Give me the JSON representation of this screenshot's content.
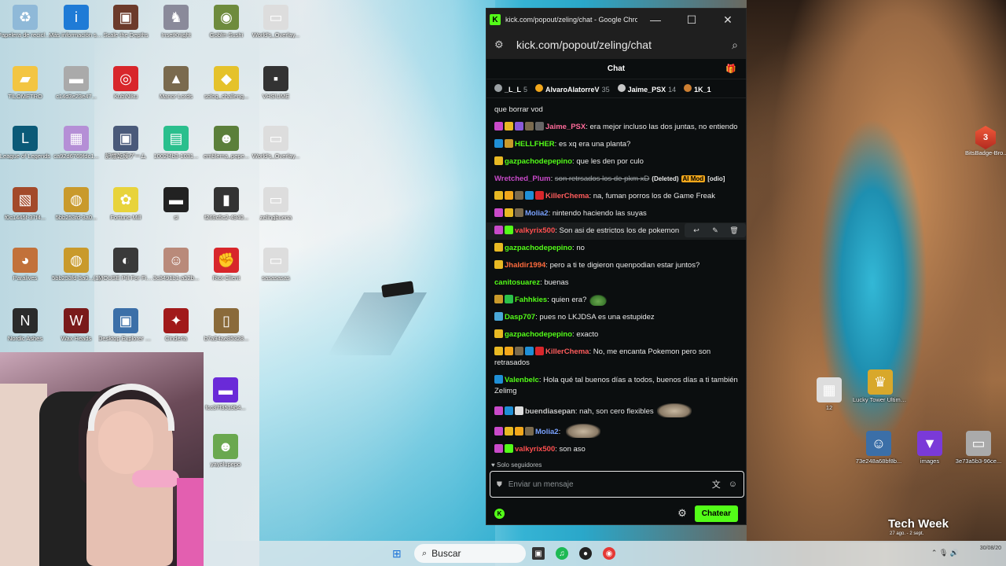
{
  "desktop": {
    "icons": [
      {
        "label": "Papelera de reciclaje",
        "color": "#8fb9d8",
        "glyph": "♻"
      },
      {
        "label": "Más información sobre esta ima...",
        "color": "#1f7bd6",
        "glyph": "i"
      },
      {
        "label": "Scale the Depths",
        "color": "#6c3b2b",
        "glyph": "▣"
      },
      {
        "label": "InsetKnight",
        "color": "#8a8a9a",
        "glyph": "♞"
      },
      {
        "label": "Goblin Sushi",
        "color": "#6e8b3d",
        "glyph": "◉"
      },
      {
        "label": "World's_Overlay...",
        "color": "#dddddd",
        "glyph": "▭"
      },
      {
        "label": "TILOMETRO",
        "color": "#f3c542",
        "glyph": "▰"
      },
      {
        "label": "c14d3e23e47...",
        "color": "#aaaaaa",
        "glyph": "▬"
      },
      {
        "label": "KubiNiku",
        "color": "#d8262b",
        "glyph": "◎"
      },
      {
        "label": "Manor Lords",
        "color": "#7a6a4e",
        "glyph": "▲"
      },
      {
        "label": "soloq_challeng...",
        "color": "#e5c22b",
        "glyph": "◆"
      },
      {
        "label": "VHS!UME",
        "color": "#333333",
        "glyph": "▪"
      },
      {
        "label": "League of Legends",
        "color": "#0b5a78",
        "glyph": "L"
      },
      {
        "label": "ca92d6769fdc1...",
        "color": "#b58fd6",
        "glyph": "▦"
      },
      {
        "label": "記憶乾燥ゲーム",
        "color": "#4a5a7a",
        "glyph": "▣"
      },
      {
        "label": "1002f4b3-1031...",
        "color": "#2abf8d",
        "glyph": "▤"
      },
      {
        "label": "emblema_pepe...",
        "color": "#5b7f3a",
        "glyph": "☻"
      },
      {
        "label": "World's_Overlay...",
        "color": "#dddddd",
        "glyph": "▭"
      },
      {
        "label": "f0c1445f-37f4...",
        "color": "#a34a2a",
        "glyph": "▧"
      },
      {
        "label": "5bb253fd-3a0...",
        "color": "#c99a2b",
        "glyph": "◍"
      },
      {
        "label": "Fortune Mill",
        "color": "#e8d33b",
        "glyph": "✿"
      },
      {
        "label": "si",
        "color": "#222222",
        "glyph": "▬"
      },
      {
        "label": "f269c5c2-4940...",
        "color": "#333333",
        "glyph": "▮"
      },
      {
        "label": "zelingbuena",
        "color": "#dddddd",
        "glyph": "▭"
      },
      {
        "label": "Paralives",
        "color": "#c2713a",
        "glyph": "◕"
      },
      {
        "label": "5bb253fd-3a0...(1)",
        "color": "#c99a2b",
        "glyph": "◍"
      },
      {
        "label": "MOUSE Pill For Filter",
        "color": "#3a3a3a",
        "glyph": "◐"
      },
      {
        "label": "3c3491b1-a52b...",
        "color": "#b98a7a",
        "glyph": "☺"
      },
      {
        "label": "Riot Client",
        "color": "#d8262b",
        "glyph": "✊"
      },
      {
        "label": "sasasasas",
        "color": "#dddddd",
        "glyph": "▭"
      },
      {
        "label": "Nordic Ashes",
        "color": "#2b2b2b",
        "glyph": "N"
      },
      {
        "label": "Wax Heads",
        "color": "#7a1a1a",
        "glyph": "W"
      },
      {
        "label": "Desktop Explorer Demo",
        "color": "#3b6fa8",
        "glyph": "▣"
      },
      {
        "label": "Cinderia",
        "color": "#a11a1a",
        "glyph": "✦"
      },
      {
        "label": "b7a94ae85328...",
        "color": "#8a6a3a",
        "glyph": "▯"
      }
    ],
    "extra_icons": [
      {
        "label": "fcc37f3519b4...",
        "color": "#6a2ad8",
        "glyph": "▬"
      },
      {
        "label": "yayolupepo",
        "color": "#6aa84f",
        "glyph": "☻"
      },
      {
        "label": "12",
        "color": "#dddddd",
        "glyph": "▦"
      },
      {
        "label": "Lucky Tower Ultimate",
        "color": "#d8a82b",
        "glyph": "♛"
      },
      {
        "label": "73e248a68bf8b...",
        "color": "#3b6fa8",
        "glyph": "☺"
      },
      {
        "label": "images",
        "color": "#7a3ad8",
        "glyph": "▼"
      },
      {
        "label": "3e73a5b3-96ce...",
        "color": "#aaaaaa",
        "glyph": "▭"
      }
    ],
    "bits_badge": {
      "label": "BitsBadge-Bro...",
      "value": "3"
    }
  },
  "browser": {
    "title": "kick.com/popout/zeling/chat - Google Chro...",
    "url": "kick.com/popout/zeling/chat",
    "minimize": "—",
    "maximize": "☐",
    "close": "✕"
  },
  "chat": {
    "header": "Chat",
    "leaderboard": [
      {
        "name": "_L_L",
        "count": "5",
        "color": "#9aa0a3"
      },
      {
        "name": "AlvaroAlatorreV",
        "count": "35",
        "color": "#f2a71b"
      },
      {
        "name": "Jaime_PSX",
        "count": "14",
        "color": "#c7c7c7"
      },
      {
        "name": "1K_1",
        "count": "",
        "color": "#cd7f32"
      }
    ],
    "messages": [
      {
        "user": "",
        "user_color": "#ffffff",
        "text": "que borrar vod",
        "badges": []
      },
      {
        "user": "Jaime_PSX",
        "user_color": "#ff6b9a",
        "text": "era mejor incluso las dos juntas, no entiendo",
        "badges": [
          "#c94ac9",
          "#e8b923",
          "#8a5ad8",
          "#7a6a4e",
          "#666666"
        ]
      },
      {
        "user": "HELLFHER",
        "user_color": "#53fc18",
        "text": "es xq era una planta?",
        "badges": [
          "#1f8fd6",
          "#c99a2b"
        ]
      },
      {
        "user": "gazpachodepepino",
        "user_color": "#53fc18",
        "text": "que les den por culo",
        "badges": [
          "#e8b923"
        ]
      },
      {
        "user": "Wretched_Plum",
        "user_color": "#c94ac9",
        "text": "son retrsados los de pkm xD",
        "deleted": "(Deleted)",
        "tag_ai": "AI Mod",
        "tag2": "[odio]",
        "badges": []
      },
      {
        "user": "KillerChema",
        "user_color": "#ff5c5c",
        "text": "na, fuman porros los de Game Freak",
        "badges": [
          "#e8b923",
          "#f2a71b",
          "#7a6a4e",
          "#1f8fd6",
          "#d8262b"
        ]
      },
      {
        "user": "Molia2",
        "user_color": "#7aa2ff",
        "text": "nintendo haciendo las suyas",
        "badges": [
          "#c94ac9",
          "#e8b923",
          "#7a6a4e"
        ]
      },
      {
        "user": "valkyrix500",
        "user_color": "#ff4f4f",
        "text": "Son asi de estrictos los de pokemon",
        "badges": [
          "#c94ac9",
          "#53fc18"
        ],
        "hover": true
      },
      {
        "user": "gazpachodepepino",
        "user_color": "#53fc18",
        "text": "no",
        "badges": [
          "#e8b923"
        ]
      },
      {
        "user": "Jhaldir1994",
        "user_color": "#ff6b3d",
        "text": "pero a ti te digieron quenpodian estar juntos?",
        "badges": [
          "#e8b923"
        ]
      },
      {
        "user": "canitosuarez",
        "user_color": "#53fc18",
        "text": "buenas",
        "badges": []
      },
      {
        "user": "Fahhkies",
        "user_color": "#53fc18",
        "text": "quien era?",
        "badges": [
          "#c99a2b",
          "#2bc24a"
        ],
        "emote": "frog"
      },
      {
        "user": "Dasp707",
        "user_color": "#53fc18",
        "text": "pues no LKJDSA es una estupidez",
        "badges": [
          "#4aa8d8"
        ]
      },
      {
        "user": "gazpachodepepino",
        "user_color": "#53fc18",
        "text": "exacto",
        "badges": [
          "#e8b923"
        ]
      },
      {
        "user": "KillerChema",
        "user_color": "#ff5c5c",
        "text": "No, me encanta Pokemon pero son retrasados",
        "badges": [
          "#e8b923",
          "#f2a71b",
          "#7a6a4e",
          "#1f8fd6",
          "#d8262b"
        ]
      },
      {
        "user": "Valenbelc",
        "user_color": "#53fc18",
        "text": "Hola qué tal buenos días a todos, buenos días a ti también Zelimg",
        "badges": [
          "#1f8fd6"
        ]
      },
      {
        "user": "buendiasepan",
        "user_color": "#c9c9c9",
        "text": "nah, son cero flexibles",
        "badges": [
          "#c94ac9",
          "#1f8fd6",
          "#dddddd"
        ],
        "emote": "cat"
      },
      {
        "user": "Molia2",
        "user_color": "#7aa2ff",
        "text": "",
        "badges": [
          "#c94ac9",
          "#e8b923",
          "#f2a71b",
          "#7a6a4e"
        ],
        "emote": "capy"
      },
      {
        "user": "valkyrix500",
        "user_color": "#ff4f4f",
        "text": "son aso",
        "badges": [
          "#c94ac9",
          "#53fc18"
        ]
      }
    ],
    "followers_only": "Solo seguidores",
    "input_placeholder": "Enviar un mensaje",
    "send_label": "Chatear"
  },
  "taskbar": {
    "search_label": "Buscar",
    "time": "",
    "date": "30/08/20"
  },
  "overlay": {
    "tech_week": "Tech Week",
    "tech_week_sub": "27 ago. - 2 sept."
  }
}
